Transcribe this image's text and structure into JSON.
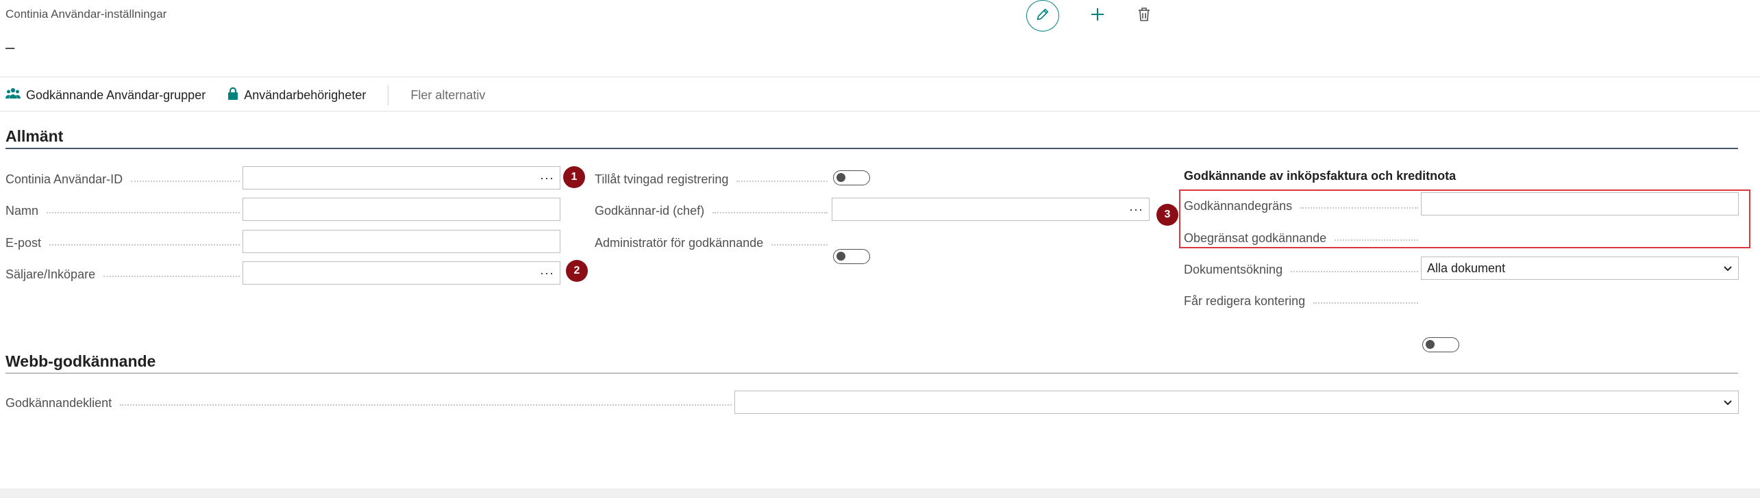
{
  "page": {
    "caption": "Continia Användar-inställningar",
    "title": "–"
  },
  "top_actions": {
    "edit_icon": "pencil-icon",
    "new_icon": "plus-icon",
    "delete_icon": "trash-icon",
    "accent": "#00827f"
  },
  "actionbar": {
    "approval_groups": "Godkännande Användar-grupper",
    "user_permissions": "Användarbehörigheter",
    "more_options": "Fler alternativ"
  },
  "sections": {
    "general": "Allmänt",
    "web_approval": "Webb-godkännande"
  },
  "general": {
    "col1": {
      "user_id_label": "Continia Användar-ID",
      "user_id_value": "",
      "name_label": "Namn",
      "name_value": "",
      "email_label": "E-post",
      "email_value": "",
      "salesperson_label": "Säljare/Inköpare",
      "salesperson_value": "",
      "lookup_glyph": "···"
    },
    "col2": {
      "forced_registration_label": "Tillåt tvingad registrering",
      "forced_registration_on": false,
      "approver_id_label": "Godkännar-id (chef)",
      "approver_id_value": "",
      "approval_admin_label": "Administratör för godkännande",
      "approval_admin_on": false
    },
    "col3": {
      "group_title": "Godkännande av inköpsfaktura och kreditnota",
      "approval_limit_label": "Godkännandegräns",
      "approval_limit_value": "",
      "unlimited_approval_label": "Obegränsat godkännande",
      "unlimited_approval_on": false,
      "document_search_label": "Dokumentsökning",
      "document_search_value": "Alla dokument",
      "edit_posting_label": "Får redigera kontering",
      "edit_posting_on": false
    }
  },
  "web": {
    "client_label": "Godkännandeklient",
    "client_value": ""
  },
  "badges": {
    "one": "1",
    "two": "2",
    "three": "3",
    "color": "#8b0d15"
  },
  "highlight_color": "#d9363e"
}
